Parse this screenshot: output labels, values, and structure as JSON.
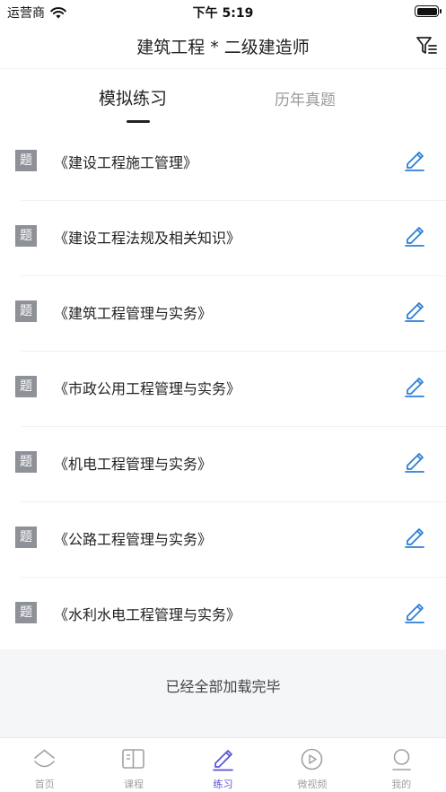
{
  "status_bar": {
    "carrier": "运营商",
    "time": "下午 5:19"
  },
  "nav": {
    "title": "建筑工程 * 二级建造师",
    "filter_icon": "filter-list-icon"
  },
  "tabs": [
    {
      "label": "模拟练习",
      "active": true
    },
    {
      "label": "历年真题",
      "active": false
    }
  ],
  "exam_list": {
    "tag_label": "题",
    "items": [
      {
        "title": "《建设工程施工管理》"
      },
      {
        "title": "《建设工程法规及相关知识》"
      },
      {
        "title": "《建筑工程管理与实务》"
      },
      {
        "title": "《市政公用工程管理与实务》"
      },
      {
        "title": "《机电工程管理与实务》"
      },
      {
        "title": "《公路工程管理与实务》"
      },
      {
        "title": "《水利水电工程管理与实务》"
      }
    ]
  },
  "load_footer": {
    "text": "已经全部加载完毕"
  },
  "tab_bar": {
    "items": [
      {
        "label": "首页",
        "icon": "home-icon",
        "active": false
      },
      {
        "label": "课程",
        "icon": "book-icon",
        "active": false
      },
      {
        "label": "练习",
        "icon": "pencil-icon",
        "active": true
      },
      {
        "label": "微视频",
        "icon": "play-circle-icon",
        "active": false
      },
      {
        "label": "我的",
        "icon": "profile-icon",
        "active": false
      }
    ]
  },
  "colors": {
    "accent": "#5a52d4",
    "edit_icon": "#2d7fd6",
    "tag_bg": "#8f9198",
    "footer_bg": "#f5f6f8",
    "inactive": "#a0a0a0"
  }
}
